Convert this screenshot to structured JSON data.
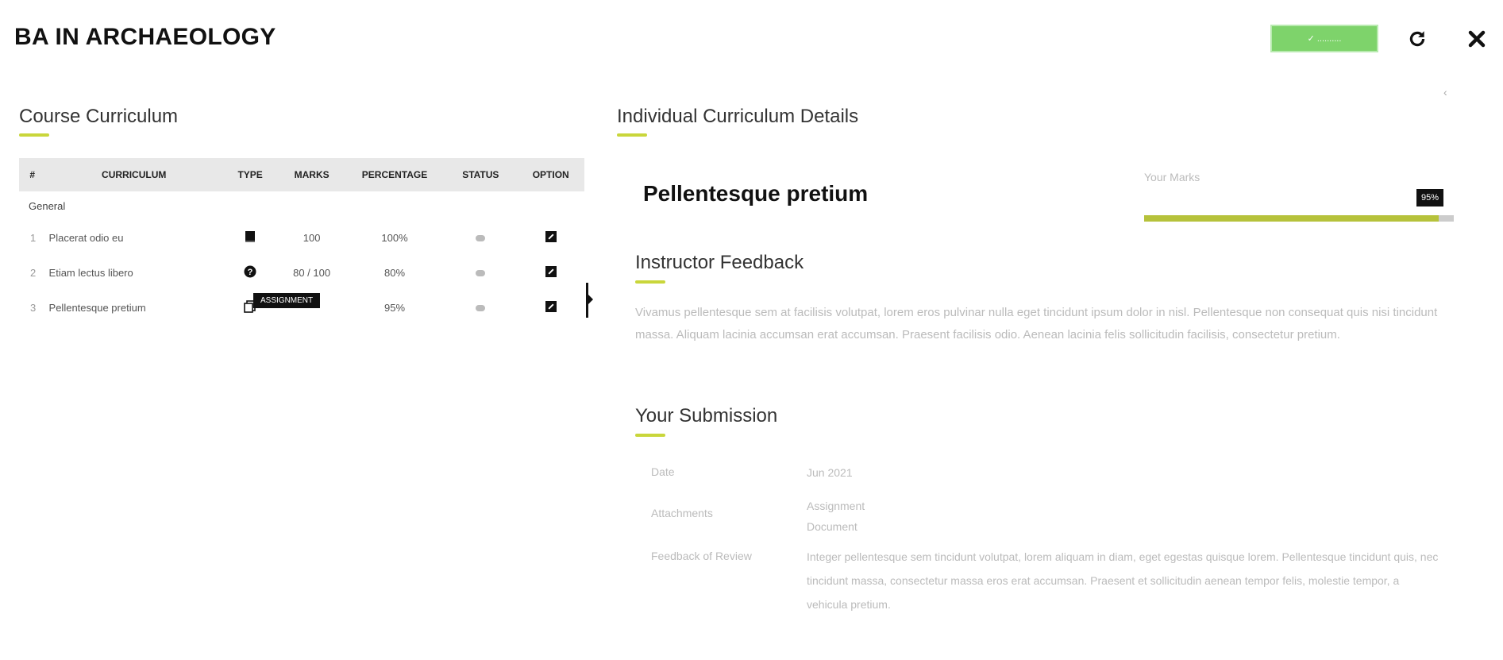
{
  "header": {
    "title": "BA IN ARCHAEOLOGY",
    "primary_button_label": "✓ ..........",
    "colors": {
      "primary": "#7ed36b",
      "accent": "#c9d63b"
    }
  },
  "left_panel": {
    "title": "Course Curriculum",
    "columns": [
      "#",
      "CURRICULUM",
      "TYPE",
      "MARKS",
      "PERCENTAGE",
      "STATUS",
      "OPTION"
    ],
    "group": "General",
    "rows": [
      {
        "num": "1",
        "name": "Placerat odio eu",
        "type_icon": "book-icon",
        "marks": "100",
        "percentage": "100%"
      },
      {
        "num": "2",
        "name": "Etiam lectus libero",
        "type_icon": "question-icon",
        "marks": "80 / 100",
        "percentage": "80%"
      },
      {
        "num": "3",
        "name": "Pellentesque pretium",
        "type_icon": "assignment-icon",
        "marks": "",
        "percentage": "95%"
      }
    ],
    "tooltip": "ASSIGNMENT"
  },
  "right_panel": {
    "title": "Individual Curriculum Details",
    "detail_title": "Pellentesque pretium",
    "progress": {
      "label": "Your Marks",
      "value": 95,
      "display": "95%"
    },
    "feedback": {
      "title": "Instructor Feedback",
      "text": "Vivamus pellentesque sem at facilisis volutpat, lorem eros pulvinar nulla eget tincidunt ipsum dolor in nisl. Pellentesque non consequat quis nisi tincidunt massa. Aliquam lacinia accumsan erat accumsan. Praesent facilisis odio. Aenean lacinia felis sollicitudin facilisis, consectetur pretium."
    },
    "submission": {
      "title": "Your Submission",
      "rows": [
        {
          "label": "Date",
          "value": "Jun 2021"
        },
        {
          "label": "Attachments",
          "value": "Assignment Document"
        },
        {
          "label": "Feedback of Review",
          "value": "Integer pellentesque sem tincidunt volutpat, lorem aliquam in diam, eget egestas quisque lorem. Pellentesque tincidunt quis, nec tincidunt massa, consectetur massa eros erat accumsan. Praesent et sollicitudin aenean tempor felis, molestie tempor, a vehicula pretium."
        }
      ]
    }
  }
}
